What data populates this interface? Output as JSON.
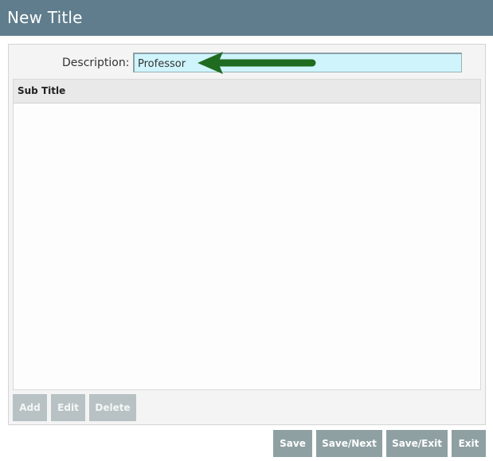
{
  "window": {
    "title": "New Title"
  },
  "form": {
    "description_label": "Description:",
    "description_value": "Professor"
  },
  "grid": {
    "columns": [
      "Sub Title"
    ],
    "rows": []
  },
  "grid_actions": {
    "add_label": "Add",
    "edit_label": "Edit",
    "delete_label": "Delete"
  },
  "footer": {
    "save_label": "Save",
    "save_next_label": "Save/Next",
    "save_exit_label": "Save/Exit",
    "exit_label": "Exit"
  },
  "annotation": {
    "arrow_icon": "arrow-left-icon",
    "arrow_color": "#1f6b1f"
  },
  "colors": {
    "titlebar": "#5f7d8c",
    "input_background": "#cff4fc",
    "button_dark": "#8fa0a3",
    "button_light": "#b8c2c4"
  }
}
